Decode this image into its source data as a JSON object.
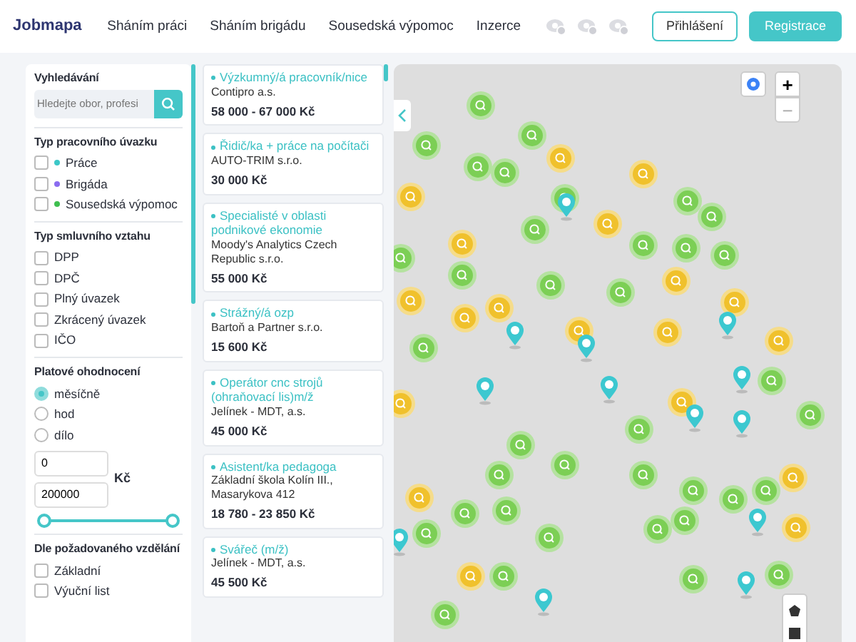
{
  "header": {
    "logo": "Jobmapa",
    "nav": [
      {
        "label": "Sháním práci"
      },
      {
        "label": "Sháním brigádu"
      },
      {
        "label": "Sousedská výpomoc"
      },
      {
        "label": "Inzerce"
      }
    ],
    "login": "Přihlášení",
    "register": "Registrace"
  },
  "filters": {
    "search": {
      "label": "Vyhledávání",
      "placeholder": "Hledejte obor, profesi"
    },
    "groups": [
      {
        "title": "Typ pracovního úvazku",
        "kind": "checkbox",
        "items": [
          {
            "label": "Práce",
            "checked": false,
            "color": "#3cc8c8"
          },
          {
            "label": "Brigáda",
            "checked": false,
            "color": "#8a6cf0"
          },
          {
            "label": "Sousedská výpomoc",
            "checked": false,
            "color": "#3fbf4f"
          }
        ]
      },
      {
        "title": "Typ smluvního vztahu",
        "kind": "checkbox",
        "items": [
          {
            "label": "DPP",
            "checked": false
          },
          {
            "label": "DPČ",
            "checked": false
          },
          {
            "label": "Plný úvazek",
            "checked": false
          },
          {
            "label": "Zkrácený úvazek",
            "checked": false
          },
          {
            "label": "IČO",
            "checked": false
          }
        ]
      },
      {
        "title": "Platové ohodnocení",
        "kind": "radio",
        "items": [
          {
            "label": "měsíčně",
            "selected": true
          },
          {
            "label": "hod",
            "selected": false
          },
          {
            "label": "dílo",
            "selected": false
          }
        ],
        "salary": {
          "min": "0",
          "max": "200000",
          "unit": "Kč",
          "range": {
            "low": {
              "level": 0
            },
            "high": {
              "level": 1
            }
          }
        }
      },
      {
        "title": "Dle požadovaného vzdělání",
        "kind": "checkbox",
        "items": [
          {
            "label": "Základní",
            "checked": false
          },
          {
            "label": "Výuční list",
            "checked": false
          }
        ]
      }
    ]
  },
  "jobs": [
    {
      "title": "Výzkumný/á pracovník/nice",
      "company": "Contipro a.s.",
      "salary": "58 000 - 67 000 Kč"
    },
    {
      "title": "Řidič/ka + práce na počítači",
      "company": "AUTO-TRIM s.r.o.",
      "salary": "30 000 Kč"
    },
    {
      "title": "Specialisté v oblasti podnikové ekonomie",
      "company": "Moody's Analytics Czech Republic s.r.o.",
      "salary": "55 000 Kč"
    },
    {
      "title": "Strážný/á ozp",
      "company": "Bartoň a Partner s.r.o.",
      "salary": "15 600 Kč"
    },
    {
      "title": "Operátor cnc strojů (ohraňovací lis)m/ž",
      "company": "Jelínek - MDT, a.s.",
      "salary": "45 000 Kč"
    },
    {
      "title": "Asistent/ka pedagoga",
      "company": "Základní škola Kolín III., Masarykova 412",
      "salary": "18 780 - 23 850 Kč"
    },
    {
      "title": "Svářeč (m/ž)",
      "company": "Jelínek - MDT, a.s.",
      "salary": "45 500 Kč"
    }
  ],
  "map": {
    "zoom_in": "+",
    "zoom_out": "−"
  }
}
